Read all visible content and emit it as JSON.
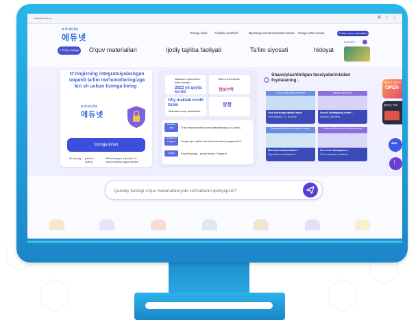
{
  "browser": {
    "url": "edunet.edu.uz"
  },
  "brand": {
    "logo_small": "또 하나의 학교",
    "logo_big": "에듀넷"
  },
  "toplinks": [
    "Tizimga kirish",
    "A'zolikka qo'shilish",
    "Mijozlarga xizmat ko'rsatish markazi",
    "Onlayn ta'lim xizmati"
  ],
  "top_pill": "Ochiq o'quv materiallari",
  "side_badge": "EDUNET",
  "nav": {
    "menu": "To'liq menyu",
    "items": [
      "O'quv materiallari",
      "Ijodiy tajriba faoliyati",
      "Ta'lim siyosati",
      "hidoyat"
    ]
  },
  "login_card": {
    "title": "O'zingizning integratsiyalashgan raqamli ta'lim ma'lumotlaringizga kiri sh uchun tizimga kiring .",
    "logo_small": "또 하나의 학교",
    "logo_big": "에듀넷",
    "button": "tizimga kirish",
    "links": [
      "ID ta\nping",
      "parolni t\nopling",
      "Bitiruvchilgan o'quvchi o'z ma'lumotlarini\nqayta tiklash"
    ]
  },
  "news": {
    "tile1": "Malakali o'qituvchilar bilan ishlash",
    "tile1b": "2022 yil qoyta ko'rib",
    "tile2": "Bilim va kreativlik",
    "tile2b": "정보수학",
    "tile3": "Olly maktab kredit tizimi",
    "tile3b": "Talabalar kursiy tanlashlari...",
    "tile4": "방정",
    "rows": [
      {
        "tag": "Izlanish\nana",
        "text": "O'rta maktab kredit tizimi talabalarning o'z-o'zlari..."
      },
      {
        "tag": "O'qituvchi\ntenglari",
        "text": "Yangi o'quv yilida bahsberil savollari yangilandi! O..."
      },
      {
        "tag": "voqea",
        "text": "Eduneti yangi - portal ishlari / Ozgardi"
      }
    ]
  },
  "reco": {
    "title": "Shaxsiylashtirilgan tavsiyalarimizdan foydalaning .",
    "items": [
      {
        "head": "O'quv materiallari elementi",
        "label": "Guz boshlaga qarab hayot",
        "sub": "O'rta maktab 1-2 | Umumiy"
      },
      {
        "head": "Maxsus ta'lim fani",
        "label": "Ovozli fizikagning elektr ...",
        "sub": "Umumiy | Bo'limlar"
      },
      {
        "head": "Maxsus ta'lim fani va elektron resurs",
        "label": "Marvarid mahsulotlari...",
        "sub": "Sayoxatchi va tarbiyalash..."
      },
      {
        "head": "Maxsus ta'lim fani va elektron resurs",
        "label": "O'z-o'zini boshqaruv...",
        "sub": "Til va madaniyat qo'llanma"
      }
    ]
  },
  "side_banner": {
    "title": "OPEN",
    "sub": "에듀넷 티-클리어",
    "label": "찾아가는 학교"
  },
  "search": {
    "placeholder": "Qanday turdagi o'quv materiallari yoki xizmatlarini qidiryapsiz?"
  },
  "colors": {
    "bezel": "#23a2e0",
    "accent": "#5a3fd1",
    "nav_blue": "#3d5bd8"
  }
}
